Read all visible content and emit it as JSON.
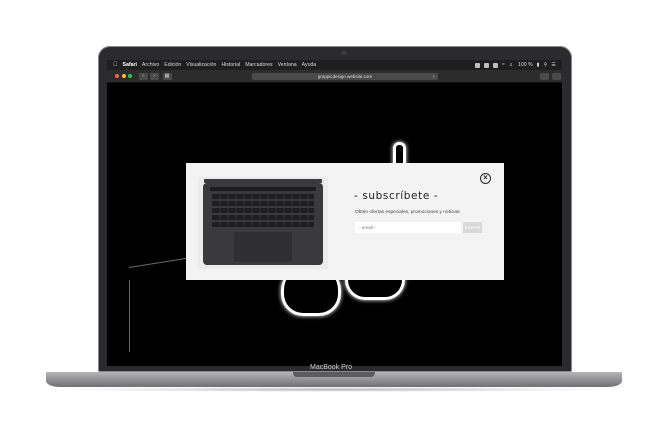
{
  "device": {
    "label": "MacBook Pro"
  },
  "menubar": {
    "app_name": "Safari",
    "items": [
      "Archivo",
      "Edición",
      "Visualización",
      "Historial",
      "Marcadores",
      "Ventana",
      "Ayuda"
    ],
    "battery": "100 %"
  },
  "browser": {
    "address": "grappicdesign.website.com"
  },
  "modal": {
    "title": "- subscríbete -",
    "description": "Obtén ofertas especiales, promociones y noticias.",
    "email_placeholder": "- email -",
    "submit_label": "ENVIAR",
    "close_glyph": "×"
  },
  "colors": {
    "traffic_red": "#ff5f57",
    "traffic_yellow": "#febc2e",
    "traffic_green": "#28c840",
    "modal_bg": "#f3f3f3",
    "screen_bg": "#000000"
  }
}
